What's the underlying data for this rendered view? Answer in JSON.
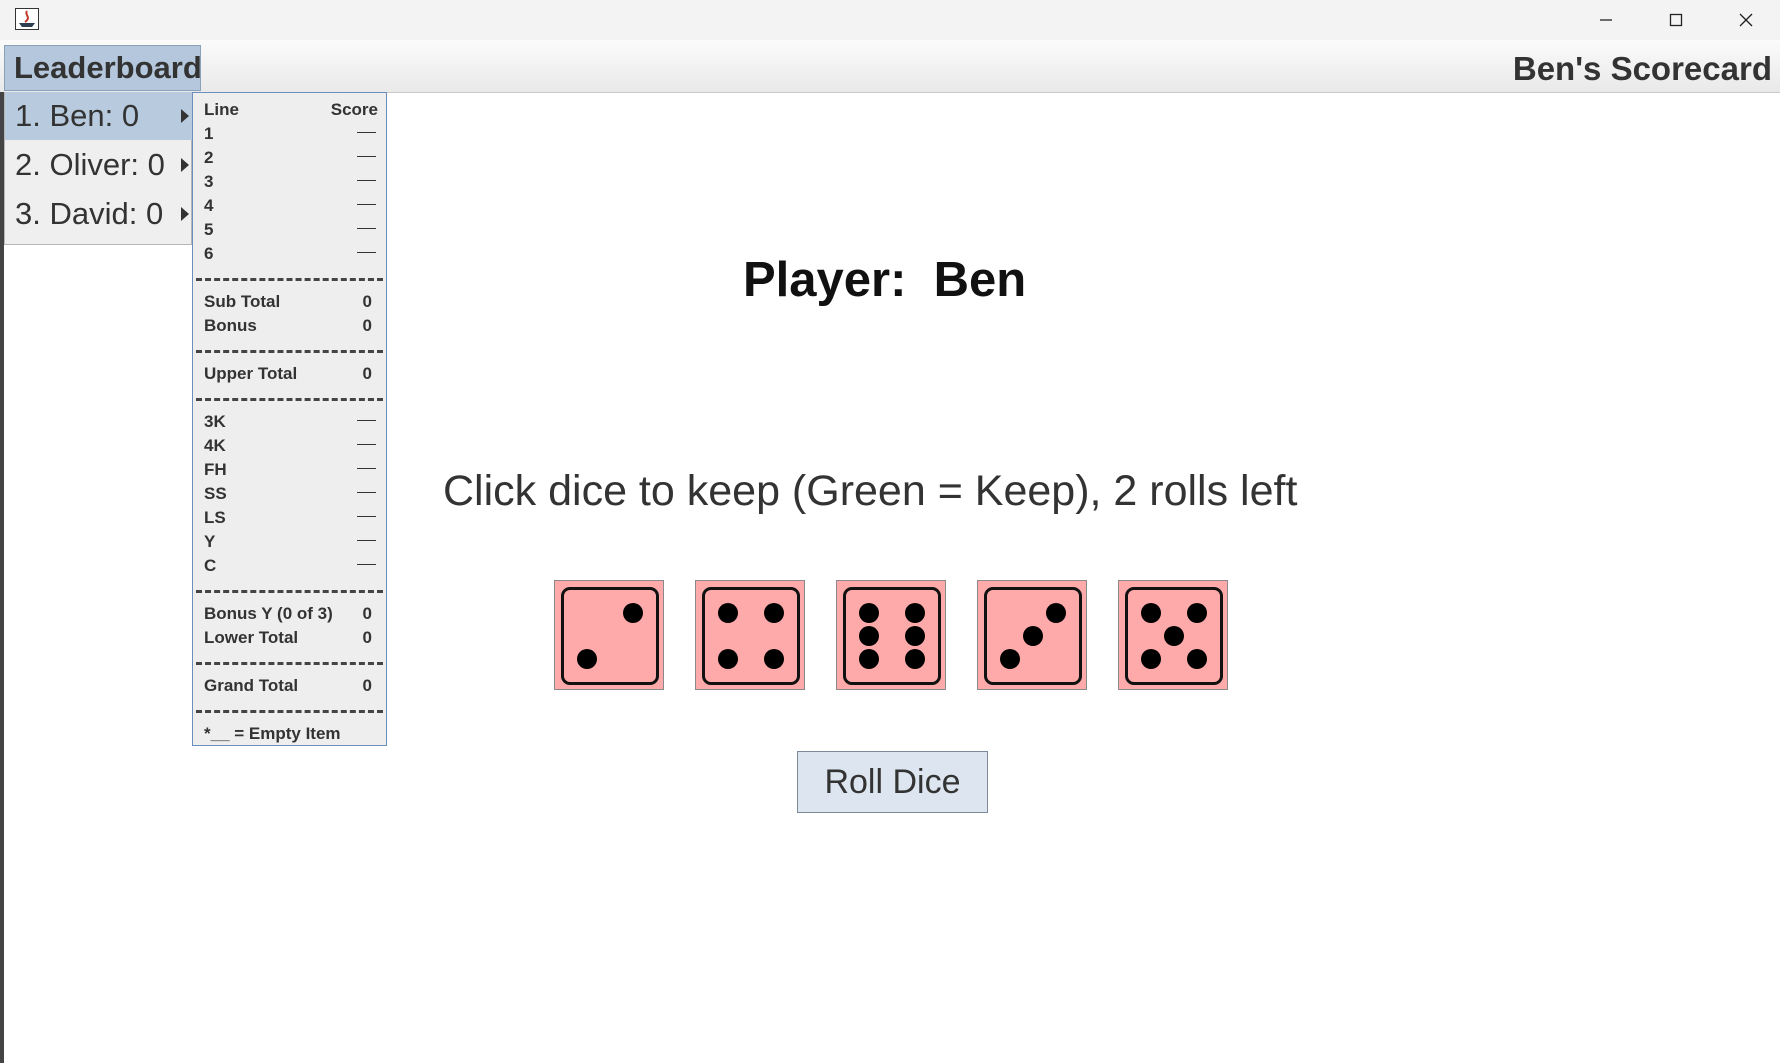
{
  "window": {
    "controls": [
      "minimize-icon",
      "maximize-icon",
      "close-icon"
    ]
  },
  "menubar": {
    "leaderboard_label": "Leaderboard",
    "scorecard_title": "Ben's Scorecard"
  },
  "leaderboard": {
    "items": [
      {
        "label": "1. Ben: 0",
        "selected": true
      },
      {
        "label": "2. Oliver: 0",
        "selected": false
      },
      {
        "label": "3. David: 0",
        "selected": false
      }
    ]
  },
  "scorecard": {
    "header": {
      "line": "Line",
      "score": "Score"
    },
    "upper": [
      {
        "label": "1",
        "value": ""
      },
      {
        "label": "2",
        "value": ""
      },
      {
        "label": "3",
        "value": ""
      },
      {
        "label": "4",
        "value": ""
      },
      {
        "label": "5",
        "value": ""
      },
      {
        "label": "6",
        "value": ""
      }
    ],
    "subtotal": {
      "label": "Sub Total",
      "value": "0"
    },
    "bonus": {
      "label": "Bonus",
      "value": "0"
    },
    "upper_total": {
      "label": "Upper Total",
      "value": "0"
    },
    "lower": [
      {
        "label": "3K",
        "value": ""
      },
      {
        "label": "4K",
        "value": ""
      },
      {
        "label": "FH",
        "value": ""
      },
      {
        "label": "SS",
        "value": ""
      },
      {
        "label": "LS",
        "value": ""
      },
      {
        "label": "Y",
        "value": ""
      },
      {
        "label": "C",
        "value": ""
      }
    ],
    "bonus_y": {
      "label": "Bonus Y (0 of 3)",
      "value": "0"
    },
    "lower_total": {
      "label": "Lower Total",
      "value": "0"
    },
    "grand_total": {
      "label": "Grand Total",
      "value": "0"
    },
    "footnote": "*__ = Empty Item"
  },
  "game": {
    "player_text": "Player:  Ben",
    "instructions": "Click dice to keep (Green = Keep), 2 rolls left",
    "dice": [
      2,
      4,
      6,
      3,
      5
    ],
    "dice_color": "#ffaaaa",
    "roll_button": "Roll Dice"
  }
}
